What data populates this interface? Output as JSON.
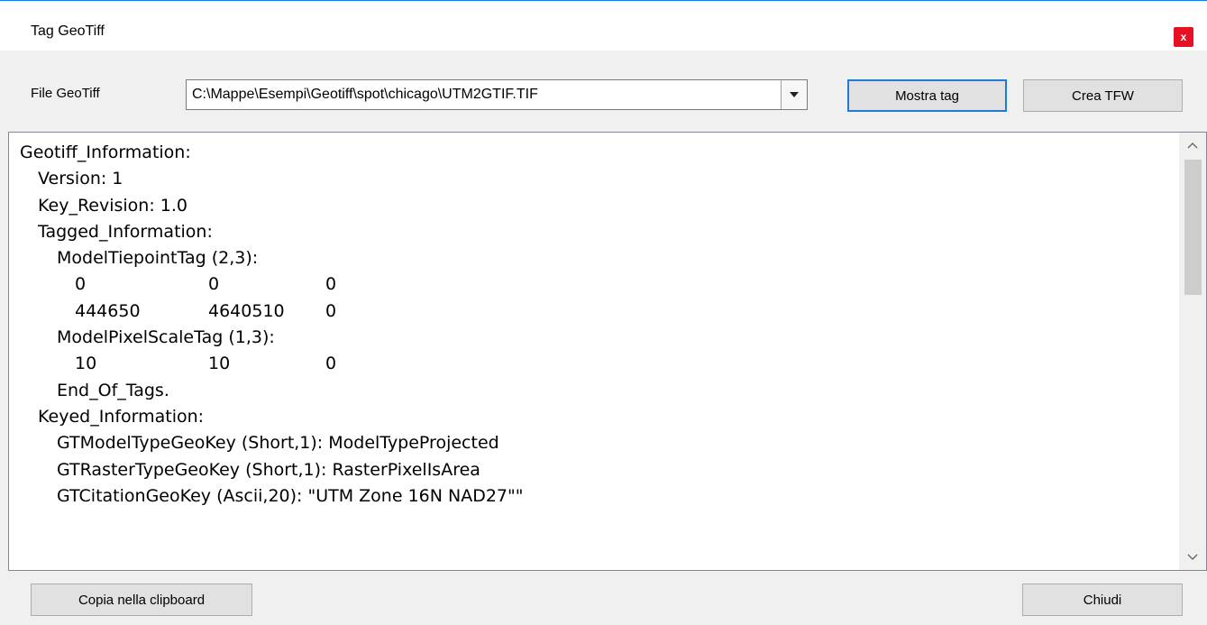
{
  "window": {
    "title": "Tag GeoTiff",
    "close_icon": "close-icon",
    "close_glyph": "x",
    "accent": "#1e7bd8",
    "close_bg": "#e81123"
  },
  "file_row": {
    "label": "File GeoTiff",
    "path_value": "C:\\Mappe\\Esempi\\Geotiff\\spot\\chicago\\UTM2GTIF.TIF",
    "dropdown_icon": "chevron-down-icon"
  },
  "buttons": {
    "show_tags": "Mostra tag",
    "create_tfw": "Crea TFW",
    "copy_clipboard": "Copia nella clipboard",
    "close": "Chiudi"
  },
  "output": {
    "lines": [
      {
        "indent": 0,
        "text": "Geotiff_Information:"
      },
      {
        "indent": 1,
        "text": "Version: 1"
      },
      {
        "indent": 1,
        "text": "Key_Revision: 1.0"
      },
      {
        "indent": 1,
        "text": "Tagged_Information:"
      },
      {
        "indent": 2,
        "text": "ModelTiepointTag (2,3):"
      },
      {
        "indent": 3,
        "cells": [
          "0",
          "0",
          "0"
        ]
      },
      {
        "indent": 3,
        "cells": [
          "444650",
          "4640510",
          "0"
        ]
      },
      {
        "indent": 2,
        "text": "ModelPixelScaleTag (1,3):"
      },
      {
        "indent": 3,
        "cells": [
          "10",
          "10",
          "0"
        ]
      },
      {
        "indent": 2,
        "text": "End_Of_Tags."
      },
      {
        "indent": 1,
        "text": "Keyed_Information:"
      },
      {
        "indent": 2,
        "text": "GTModelTypeGeoKey (Short,1): ModelTypeProjected"
      },
      {
        "indent": 2,
        "text": "GTRasterTypeGeoKey (Short,1): RasterPixelIsArea"
      },
      {
        "indent": 2,
        "text": "GTCitationGeoKey (Ascii,20): \"UTM Zone 16N NAD27\"\""
      }
    ],
    "scroll_up_icon": "chevron-up-icon",
    "scroll_down_icon": "chevron-down-icon"
  }
}
